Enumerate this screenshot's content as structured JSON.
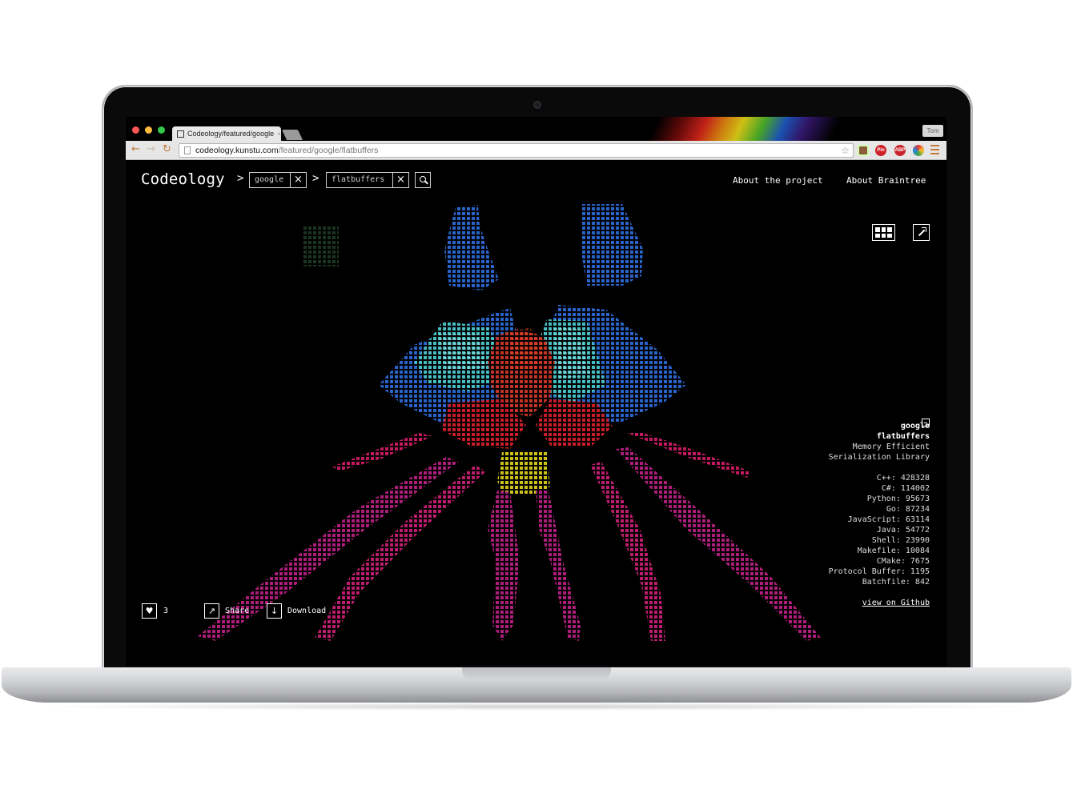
{
  "browser": {
    "tab_title": "Codeology/featured/google",
    "tab_close": "×",
    "profile_name": "Tom",
    "url_host": "codeology.kunstu.com",
    "url_path": "/featured/google/flatbuffers",
    "extensions": [
      "instagram-icon",
      "Pin",
      "ABP",
      "color-picker-icon"
    ]
  },
  "header": {
    "logo": "Codeology",
    "separator": ">",
    "crumbs": [
      {
        "label": "google",
        "clear": "×"
      },
      {
        "label": "flatbuffers",
        "clear": "×"
      }
    ],
    "nav": {
      "about_project": "About the project",
      "about_braintree": "About Braintree"
    }
  },
  "repo": {
    "owner": "google",
    "name": "flatbuffers",
    "description_line1": "Memory Efficient",
    "description_line2": "Serialization Library",
    "languages": [
      {
        "name": "C++",
        "lines": 428328
      },
      {
        "name": "C#",
        "lines": 114002
      },
      {
        "name": "Python",
        "lines": 95673
      },
      {
        "name": "Go",
        "lines": 87234
      },
      {
        "name": "JavaScript",
        "lines": 63114
      },
      {
        "name": "Java",
        "lines": 54772
      },
      {
        "name": "Shell",
        "lines": 23990
      },
      {
        "name": "Makefile",
        "lines": 10084
      },
      {
        "name": "CMake",
        "lines": 7675
      },
      {
        "name": "Protocol Buffer",
        "lines": 1195
      },
      {
        "name": "Batchfile",
        "lines": 842
      }
    ],
    "github_link": "view on Github"
  },
  "actions": {
    "likes": "3",
    "share": "Share",
    "download": "Download"
  },
  "colors": {
    "background": "#000000",
    "blue": "#2e6fe0",
    "cyan": "#4ed0d8",
    "red": "#e0202c",
    "magenta": "#c0208a"
  }
}
